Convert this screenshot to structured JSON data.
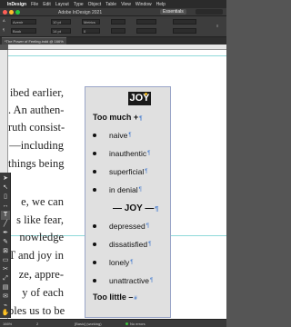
{
  "menubar": {
    "app_name": "InDesign",
    "items": [
      "File",
      "Edit",
      "Layout",
      "Type",
      "Object",
      "Table",
      "View",
      "Window",
      "Help"
    ]
  },
  "window": {
    "title": "Adobe InDesign 2021",
    "workspace": "Essentials"
  },
  "control_panel": {
    "font_family": "Avenir",
    "font_style": "Book",
    "font_size": "10 pt",
    "leading": "14 pt",
    "tracking": "0",
    "kerning": "Metrics"
  },
  "document_tab": {
    "label": "*The Power of Feeling.indd @ 166%"
  },
  "body_text": {
    "lines": [
      "ibed earlier,",
      ". An authen-",
      "ruth consist-",
      "—including",
      "things being",
      "",
      "",
      "e, we can",
      "s like fear,",
      "nowledge",
      "T and joy in",
      "ze, appre-",
      "y of each",
      "ples us to be"
    ]
  },
  "sidebar": {
    "logo_text": "JOY",
    "heading_top": "Too much +",
    "items_top": [
      "naive",
      "inauthentic",
      "superficial",
      "in denial"
    ],
    "center_label": "— JOY —",
    "items_bottom": [
      "depressed",
      "dissatisfied",
      "lonely",
      "unattractive"
    ],
    "heading_bottom": "Too little –",
    "marks": {
      "paragraph": "¶",
      "end_of_story": "#"
    }
  },
  "toolbar": {
    "tools": [
      "selection-tool",
      "direct-selection-tool",
      "page-tool",
      "gap-tool",
      "type-tool",
      "line-tool",
      "pen-tool",
      "pencil-tool",
      "rectangle-frame-tool",
      "rectangle-tool",
      "scissors-tool",
      "free-transform-tool",
      "gradient-tool",
      "note-tool",
      "eyedropper-tool",
      "hand-tool",
      "zoom-tool"
    ],
    "type_glyph": "T"
  },
  "statusbar": {
    "zoom": "166%",
    "page": "2",
    "style": "[Basic] (working)",
    "errors": "No errors"
  },
  "colors": {
    "accent": "#4a7fd0",
    "guide": "#8fd9d9",
    "sidebar_bg": "#e0e0e0",
    "logo_dot": "#e8b21a"
  }
}
